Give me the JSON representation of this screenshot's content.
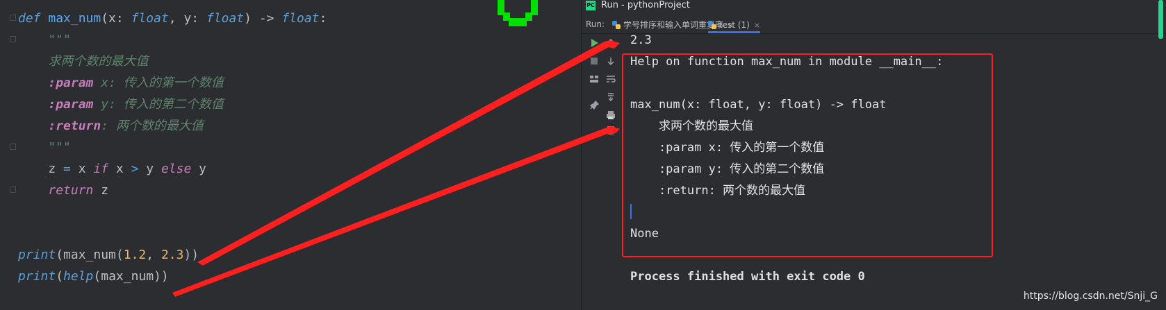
{
  "editor": {
    "lines": [
      {
        "parts": [
          {
            "t": "def ",
            "c": "kw"
          },
          {
            "t": "max_num",
            "c": "fn"
          },
          {
            "t": "(x: ",
            "c": "plain"
          },
          {
            "t": "float",
            "c": "ty"
          },
          {
            "t": ", y: ",
            "c": "plain"
          },
          {
            "t": "float",
            "c": "ty"
          },
          {
            "t": ") -> ",
            "c": "plain"
          },
          {
            "t": "float",
            "c": "ty"
          },
          {
            "t": ":",
            "c": "plain"
          }
        ]
      },
      {
        "parts": [
          {
            "t": "    \"\"\"",
            "c": "doc"
          }
        ]
      },
      {
        "parts": [
          {
            "t": "    求两个数的最大值",
            "c": "doc"
          }
        ]
      },
      {
        "parts": [
          {
            "t": "    ",
            "c": "plain"
          },
          {
            "t": ":param",
            "c": "tag"
          },
          {
            "t": " x: 传入的第一个数值",
            "c": "doc"
          }
        ]
      },
      {
        "parts": [
          {
            "t": "    ",
            "c": "plain"
          },
          {
            "t": ":param",
            "c": "tag"
          },
          {
            "t": " y: 传入的第二个数值",
            "c": "doc"
          }
        ]
      },
      {
        "parts": [
          {
            "t": "    ",
            "c": "plain"
          },
          {
            "t": ":return",
            "c": "tag"
          },
          {
            "t": ": 两个数的最大值",
            "c": "doc"
          }
        ]
      },
      {
        "parts": [
          {
            "t": "    \"\"\"",
            "c": "doc"
          }
        ]
      },
      {
        "parts": [
          {
            "t": "    z ",
            "c": "plain"
          },
          {
            "t": "=",
            "c": "op"
          },
          {
            "t": " x ",
            "c": "plain"
          },
          {
            "t": "if",
            "c": "ital"
          },
          {
            "t": " x ",
            "c": "plain"
          },
          {
            "t": ">",
            "c": "op"
          },
          {
            "t": " y ",
            "c": "plain"
          },
          {
            "t": "else",
            "c": "ital"
          },
          {
            "t": " y",
            "c": "plain"
          }
        ]
      },
      {
        "parts": [
          {
            "t": "    ",
            "c": "plain"
          },
          {
            "t": "return",
            "c": "ital"
          },
          {
            "t": " z",
            "c": "plain"
          }
        ]
      },
      {
        "parts": []
      },
      {
        "parts": []
      },
      {
        "parts": [
          {
            "t": "print",
            "c": "kw"
          },
          {
            "t": "(max_num(",
            "c": "plain"
          },
          {
            "t": "1.2",
            "c": "num"
          },
          {
            "t": ", ",
            "c": "plain"
          },
          {
            "t": "2.3",
            "c": "num"
          },
          {
            "t": "))",
            "c": "plain"
          }
        ]
      },
      {
        "parts": [
          {
            "t": "print",
            "c": "kw"
          },
          {
            "t": "(",
            "c": "plain"
          },
          {
            "t": "help",
            "c": "kw"
          },
          {
            "t": "(max_num))",
            "c": "plain"
          }
        ]
      }
    ]
  },
  "run_window": {
    "title": "Run - pythonProject",
    "app_icon_text": "PC",
    "run_label": "Run:",
    "tabs": [
      {
        "label": "学号排序和输入单词重复率",
        "active": false
      },
      {
        "label": "test (1)",
        "active": true
      }
    ],
    "close_glyph": "×",
    "output": [
      "2.3",
      "Help on function max_num in module __main__:",
      "",
      "max_num(x: float, y: float) -> float",
      "    求两个数的最大值",
      "    :param x: 传入的第一个数值",
      "    :param y: 传入的第二个数值",
      "    :return: 两个数的最大值",
      "",
      "None",
      "",
      "Process finished with exit code 0"
    ],
    "toolbar_icons": [
      "rerun-icon",
      "stop-icon",
      "scroll-down-icon",
      "layout-icon",
      "soft-wrap-icon",
      "scroll-to-end-icon",
      "pin-icon",
      "print-icon",
      "delete-icon"
    ]
  },
  "watermark": "https://blog.csdn.net/Snji_G",
  "colors": {
    "annotation_red": "#ff1f1f",
    "accent_blue": "#3574f0",
    "green": "#21d789"
  }
}
